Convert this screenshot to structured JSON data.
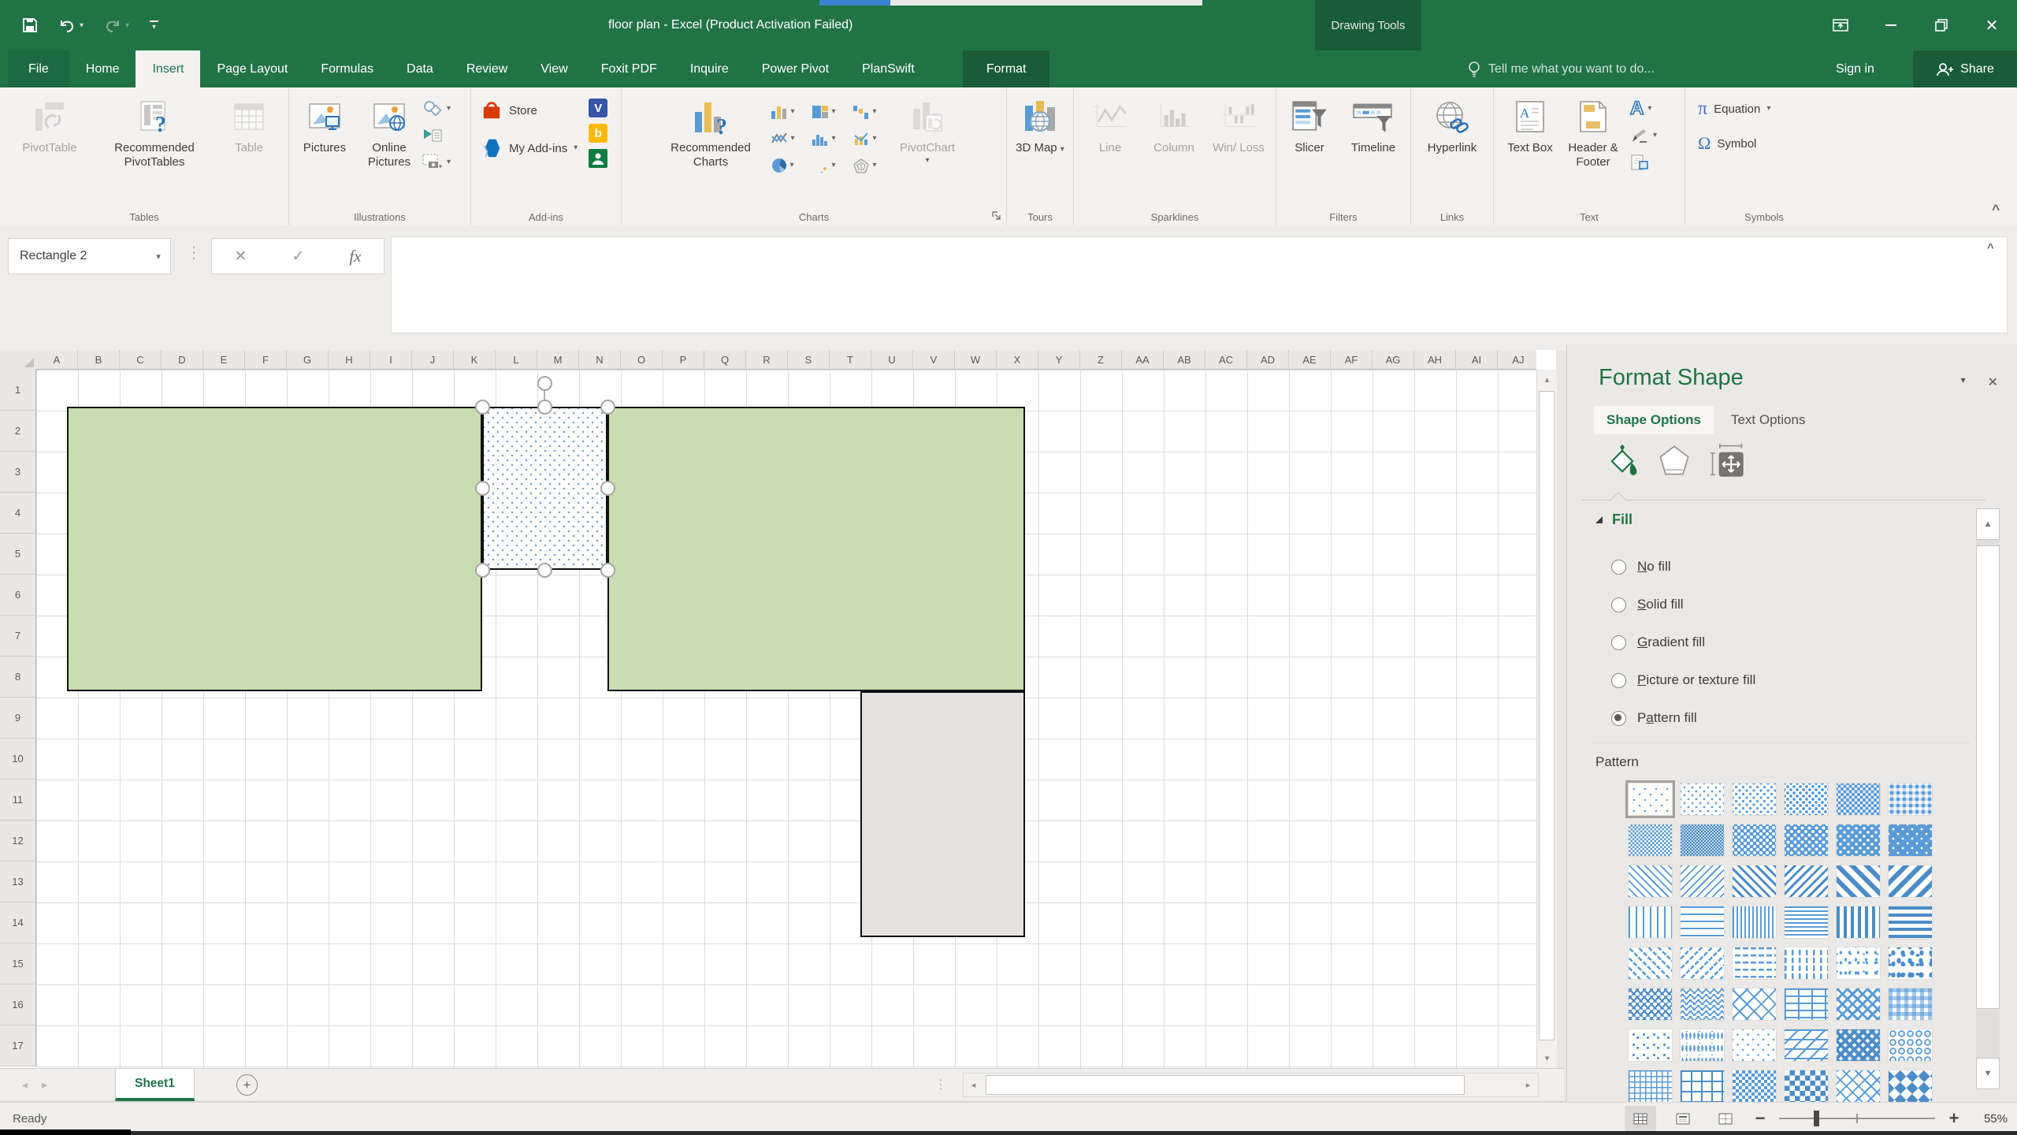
{
  "window": {
    "title": "floor plan - Excel (Product Activation Failed)",
    "context_badge": "Drawing Tools"
  },
  "tabs": {
    "items": [
      {
        "label": "File",
        "state": "file"
      },
      {
        "label": "Home"
      },
      {
        "label": "Insert",
        "state": "active"
      },
      {
        "label": "Page Layout"
      },
      {
        "label": "Formulas"
      },
      {
        "label": "Data"
      },
      {
        "label": "Review"
      },
      {
        "label": "View"
      },
      {
        "label": "Foxit PDF"
      },
      {
        "label": "Inquire"
      },
      {
        "label": "Power Pivot"
      },
      {
        "label": "PlanSwift"
      },
      {
        "label": "Format",
        "state": "context"
      }
    ],
    "tell_me": "Tell me what you want to do...",
    "sign_in": "Sign in",
    "share": "Share"
  },
  "ribbon": {
    "tables": {
      "label": "Tables",
      "pivottable": "PivotTable",
      "recommended": "Recommended PivotTables",
      "table": "Table"
    },
    "illustrations": {
      "label": "Illustrations",
      "pictures": "Pictures",
      "online_pictures": "Online Pictures"
    },
    "addins": {
      "label": "Add-ins",
      "store": "Store",
      "my_addins": "My Add-ins"
    },
    "charts": {
      "label": "Charts",
      "recommended": "Recommended Charts",
      "pivotchart": "PivotChart"
    },
    "tours": {
      "label": "Tours",
      "map3d": "3D Map"
    },
    "sparklines": {
      "label": "Sparklines",
      "line": "Line",
      "column": "Column",
      "winloss": "Win/ Loss"
    },
    "filters": {
      "label": "Filters",
      "slicer": "Slicer",
      "timeline": "Timeline"
    },
    "links": {
      "label": "Links",
      "hyperlink": "Hyperlink"
    },
    "text": {
      "label": "Text",
      "text_box": "Text Box",
      "header_footer": "Header & Footer"
    },
    "symbols": {
      "label": "Symbols",
      "equation": "Equation",
      "symbol": "Symbol"
    }
  },
  "formula_bar": {
    "name_box": "Rectangle 2"
  },
  "grid": {
    "columns": [
      "A",
      "B",
      "C",
      "D",
      "E",
      "F",
      "G",
      "H",
      "I",
      "J",
      "K",
      "L",
      "M",
      "N",
      "O",
      "P",
      "Q",
      "R",
      "S",
      "T",
      "U",
      "V",
      "W",
      "X",
      "Y",
      "Z",
      "AA",
      "AB",
      "AC",
      "AD",
      "AE",
      "AF",
      "AG",
      "AH",
      "AI",
      "AJ"
    ],
    "rows": [
      "1",
      "2",
      "3",
      "4",
      "5",
      "6",
      "7",
      "8",
      "9",
      "10",
      "11",
      "12",
      "13",
      "14",
      "15",
      "16",
      "17"
    ]
  },
  "canvas": {
    "shapes": [
      {
        "name": "room-left-green",
        "kind": "green",
        "fill": "#c9dcb2"
      },
      {
        "name": "selected-rectangle-pattern-fill",
        "kind": "dots",
        "fill": "5% pattern"
      },
      {
        "name": "room-right-green",
        "kind": "green",
        "fill": "#c9dcb2"
      },
      {
        "name": "room-bottom-gray",
        "kind": "gray",
        "fill": "#e4e3e1"
      }
    ]
  },
  "format_pane": {
    "title": "Format Shape",
    "tabs": {
      "shape_options": "Shape Options",
      "text_options": "Text Options"
    },
    "fill": {
      "heading": "Fill",
      "options": [
        {
          "label": "No fill",
          "accel": "N"
        },
        {
          "label": "Solid fill",
          "accel": "S"
        },
        {
          "label": "Gradient fill",
          "accel": "G"
        },
        {
          "label": "Picture or texture fill",
          "accel": "P"
        },
        {
          "label": "Pattern fill",
          "accel": "a",
          "selected": true
        }
      ],
      "pattern_label": "Pattern",
      "patterns": [
        {
          "name": "5%",
          "kind": "d5",
          "selected": true
        },
        {
          "name": "10%",
          "kind": "d10"
        },
        {
          "name": "20%",
          "kind": "d20"
        },
        {
          "name": "25%",
          "kind": "d25"
        },
        {
          "name": "30%",
          "kind": "d30"
        },
        {
          "name": "40%",
          "kind": "d40"
        },
        {
          "name": "50%",
          "kind": "d50"
        },
        {
          "name": "60%",
          "kind": "d60"
        },
        {
          "name": "70%",
          "kind": "d70"
        },
        {
          "name": "75%",
          "kind": "d75"
        },
        {
          "name": "80%",
          "kind": "d80"
        },
        {
          "name": "90%",
          "kind": "d90"
        },
        {
          "name": "Light downward diagonal",
          "kind": "ldd"
        },
        {
          "name": "Light upward diagonal",
          "kind": "lud"
        },
        {
          "name": "Dark downward diagonal",
          "kind": "add"
        },
        {
          "name": "Dark upward diagonal",
          "kind": "aud"
        },
        {
          "name": "Wide downward diagonal",
          "kind": "wdd"
        },
        {
          "name": "Wide upward diagonal",
          "kind": "wud"
        },
        {
          "name": "Light vertical",
          "kind": "lv"
        },
        {
          "name": "Light horizontal",
          "kind": "lh"
        },
        {
          "name": "Narrow vertical",
          "kind": "nv"
        },
        {
          "name": "Narrow horizontal",
          "kind": "nh"
        },
        {
          "name": "Dark vertical",
          "kind": "dv"
        },
        {
          "name": "Dark horizontal",
          "kind": "dh"
        },
        {
          "name": "Dashed downward diagonal",
          "kind": "dashdd"
        },
        {
          "name": "Dashed upward diagonal",
          "kind": "dashud"
        },
        {
          "name": "Dashed horizontal",
          "kind": "dashh"
        },
        {
          "name": "Dashed vertical",
          "kind": "dashv"
        },
        {
          "name": "Small confetti",
          "kind": "confs"
        },
        {
          "name": "Large confetti",
          "kind": "confl"
        },
        {
          "name": "Zig zag",
          "kind": "zig"
        },
        {
          "name": "Wave",
          "kind": "wave"
        },
        {
          "name": "Diagonal brick",
          "kind": "brickd"
        },
        {
          "name": "Horizontal brick",
          "kind": "brickh"
        },
        {
          "name": "Weave",
          "kind": "weave"
        },
        {
          "name": "Plaid",
          "kind": "plaid"
        },
        {
          "name": "Divot",
          "kind": "divot"
        },
        {
          "name": "Dotted grid",
          "kind": "dotgrid"
        },
        {
          "name": "Dotted diamond",
          "kind": "dotdia"
        },
        {
          "name": "Shingle",
          "kind": "shingle"
        },
        {
          "name": "Trellis",
          "kind": "trellis"
        },
        {
          "name": "Sphere",
          "kind": "sphere"
        },
        {
          "name": "Small grid",
          "kind": "grids"
        },
        {
          "name": "Large grid",
          "kind": "gridl"
        },
        {
          "name": "Small checker board",
          "kind": "checks"
        },
        {
          "name": "Large checker board",
          "kind": "checkl"
        },
        {
          "name": "Outlined diamond",
          "kind": "diao"
        },
        {
          "name": "Solid diamond",
          "kind": "dias"
        }
      ]
    }
  },
  "sheet_bar": {
    "tabs": [
      {
        "label": "Sheet1",
        "active": true
      }
    ]
  },
  "status_bar": {
    "ready": "Ready",
    "zoom": "55%"
  },
  "colors": {
    "accent_green": "#217346",
    "context_dark_green": "#1a5c38",
    "pattern_blue": "#5b9bd5",
    "shape_green": "#c9dcb2",
    "shape_gray": "#e4e3e1"
  }
}
